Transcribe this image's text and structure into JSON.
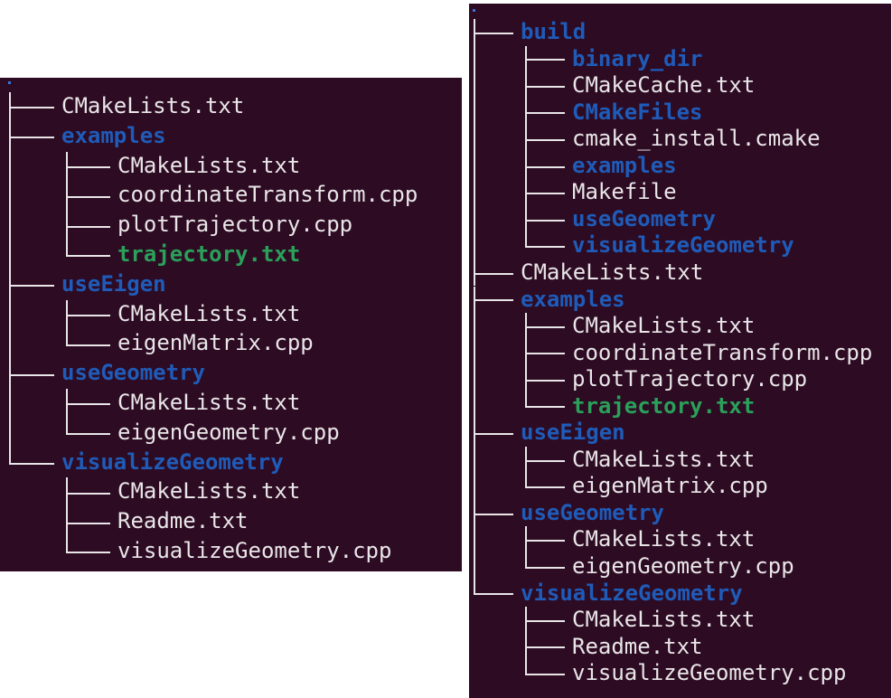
{
  "colors": {
    "background": "#2d0b23",
    "text": "#e9e6e8",
    "directory": "#1f5bb8",
    "executable": "#2aa05a"
  },
  "left_tree": {
    "root": ".",
    "entries": [
      {
        "depth": 0,
        "name": "CMakeLists.txt",
        "type": "file",
        "last": false
      },
      {
        "depth": 0,
        "name": "examples",
        "type": "dir",
        "last": false
      },
      {
        "depth": 1,
        "name": "CMakeLists.txt",
        "type": "file",
        "last": false
      },
      {
        "depth": 1,
        "name": "coordinateTransform.cpp",
        "type": "file",
        "last": false
      },
      {
        "depth": 1,
        "name": "plotTrajectory.cpp",
        "type": "file",
        "last": false
      },
      {
        "depth": 1,
        "name": "trajectory.txt",
        "type": "exec",
        "last": true
      },
      {
        "depth": 0,
        "name": "useEigen",
        "type": "dir",
        "last": false
      },
      {
        "depth": 1,
        "name": "CMakeLists.txt",
        "type": "file",
        "last": false
      },
      {
        "depth": 1,
        "name": "eigenMatrix.cpp",
        "type": "file",
        "last": true
      },
      {
        "depth": 0,
        "name": "useGeometry",
        "type": "dir",
        "last": false
      },
      {
        "depth": 1,
        "name": "CMakeLists.txt",
        "type": "file",
        "last": false
      },
      {
        "depth": 1,
        "name": "eigenGeometry.cpp",
        "type": "file",
        "last": true
      },
      {
        "depth": 0,
        "name": "visualizeGeometry",
        "type": "dir",
        "last": true
      },
      {
        "depth": 1,
        "name": "CMakeLists.txt",
        "type": "file",
        "last": false
      },
      {
        "depth": 1,
        "name": "Readme.txt",
        "type": "file",
        "last": false
      },
      {
        "depth": 1,
        "name": "visualizeGeometry.cpp",
        "type": "file",
        "last": true
      }
    ]
  },
  "right_tree": {
    "root": ".",
    "entries": [
      {
        "depth": 0,
        "name": "build",
        "type": "dir",
        "last": false
      },
      {
        "depth": 1,
        "name": "binary_dir",
        "type": "dir",
        "last": false
      },
      {
        "depth": 1,
        "name": "CMakeCache.txt",
        "type": "file",
        "last": false
      },
      {
        "depth": 1,
        "name": "CMakeFiles",
        "type": "dir",
        "last": false
      },
      {
        "depth": 1,
        "name": "cmake_install.cmake",
        "type": "file",
        "last": false
      },
      {
        "depth": 1,
        "name": "examples",
        "type": "dir",
        "last": false
      },
      {
        "depth": 1,
        "name": "Makefile",
        "type": "file",
        "last": false
      },
      {
        "depth": 1,
        "name": "useGeometry",
        "type": "dir",
        "last": false
      },
      {
        "depth": 1,
        "name": "visualizeGeometry",
        "type": "dir",
        "last": true
      },
      {
        "depth": 0,
        "name": "CMakeLists.txt",
        "type": "file",
        "last": false
      },
      {
        "depth": 0,
        "name": "examples",
        "type": "dir",
        "last": false
      },
      {
        "depth": 1,
        "name": "CMakeLists.txt",
        "type": "file",
        "last": false
      },
      {
        "depth": 1,
        "name": "coordinateTransform.cpp",
        "type": "file",
        "last": false
      },
      {
        "depth": 1,
        "name": "plotTrajectory.cpp",
        "type": "file",
        "last": false
      },
      {
        "depth": 1,
        "name": "trajectory.txt",
        "type": "exec",
        "last": true
      },
      {
        "depth": 0,
        "name": "useEigen",
        "type": "dir",
        "last": false
      },
      {
        "depth": 1,
        "name": "CMakeLists.txt",
        "type": "file",
        "last": false
      },
      {
        "depth": 1,
        "name": "eigenMatrix.cpp",
        "type": "file",
        "last": true
      },
      {
        "depth": 0,
        "name": "useGeometry",
        "type": "dir",
        "last": false
      },
      {
        "depth": 1,
        "name": "CMakeLists.txt",
        "type": "file",
        "last": false
      },
      {
        "depth": 1,
        "name": "eigenGeometry.cpp",
        "type": "file",
        "last": true
      },
      {
        "depth": 0,
        "name": "visualizeGeometry",
        "type": "dir",
        "last": true
      },
      {
        "depth": 1,
        "name": "CMakeLists.txt",
        "type": "file",
        "last": false
      },
      {
        "depth": 1,
        "name": "Readme.txt",
        "type": "file",
        "last": false
      },
      {
        "depth": 1,
        "name": "visualizeGeometry.cpp",
        "type": "file",
        "last": true
      }
    ]
  }
}
